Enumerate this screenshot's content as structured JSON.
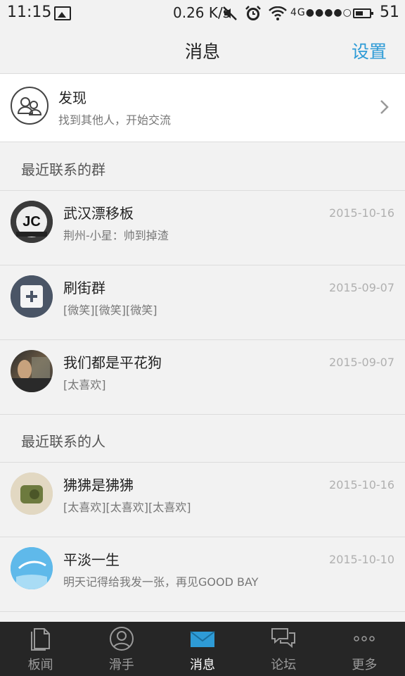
{
  "status_bar": {
    "time": "11:15",
    "net_speed": "0.26 K/s",
    "network": "4G●●●●○",
    "battery_level": "51"
  },
  "header": {
    "title": "消息",
    "settings_label": "设置"
  },
  "discover": {
    "title": "发现",
    "subtitle": "找到其他人，开始交流"
  },
  "sections": {
    "groups_header": "最近联系的群",
    "people_header": "最近联系的人"
  },
  "groups": [
    {
      "name": "武汉漂移板",
      "last_message": "荆州-小星：帅到掉渣",
      "date": "2015-10-16",
      "avatar_text": "JC"
    },
    {
      "name": "刷街群",
      "last_message": "[微笑][微笑][微笑]",
      "date": "2015-09-07"
    },
    {
      "name": "我们都是平花狗",
      "last_message": "[太喜欢]",
      "date": "2015-09-07"
    }
  ],
  "people": [
    {
      "name": "狒狒是狒狒",
      "last_message": "[太喜欢][太喜欢][太喜欢]",
      "date": "2015-10-16"
    },
    {
      "name": "平淡一生",
      "last_message": "明天记得给我发一张，再见GOOD BAY",
      "date": "2015-10-10"
    }
  ],
  "tabs": [
    {
      "label": "板闻",
      "icon": "document-icon"
    },
    {
      "label": "滑手",
      "icon": "person-icon"
    },
    {
      "label": "消息",
      "icon": "envelope-icon",
      "active": true
    },
    {
      "label": "论坛",
      "icon": "chat-bubbles-icon"
    },
    {
      "label": "更多",
      "icon": "more-dots-icon"
    }
  ],
  "colors": {
    "accent": "#2e9bd6",
    "tabbar_bg": "#262626",
    "background": "#f2f2f2"
  }
}
